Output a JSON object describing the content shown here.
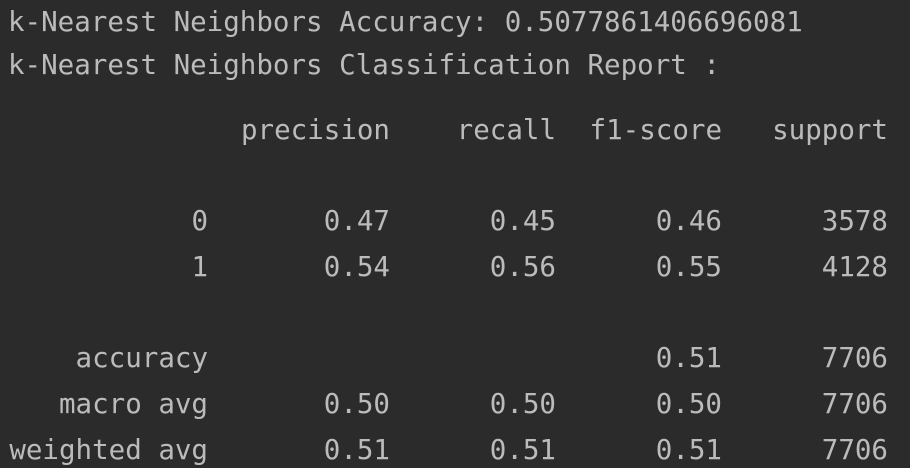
{
  "console": {
    "accuracy_line": "k-Nearest Neighbors Accuracy: 0.5077861406696081",
    "report_title": "k-Nearest Neighbors Classification Report :"
  },
  "report": {
    "columns": {
      "precision": "precision",
      "recall": "recall",
      "f1": "f1-score",
      "support": "support"
    },
    "rows": [
      {
        "label": "0",
        "precision": "0.47",
        "recall": "0.45",
        "f1": "0.46",
        "support": "3578"
      },
      {
        "label": "1",
        "precision": "0.54",
        "recall": "0.56",
        "f1": "0.55",
        "support": "4128"
      }
    ],
    "accuracy": {
      "label": "accuracy",
      "f1": "0.51",
      "support": "7706"
    },
    "macro": {
      "label": "macro avg",
      "precision": "0.50",
      "recall": "0.50",
      "f1": "0.50",
      "support": "7706"
    },
    "weighted": {
      "label": "weighted avg",
      "precision": "0.51",
      "recall": "0.51",
      "f1": "0.51",
      "support": "7706"
    }
  },
  "colors": {
    "background": "#2b2b2b",
    "text": "#bbbbbb"
  }
}
